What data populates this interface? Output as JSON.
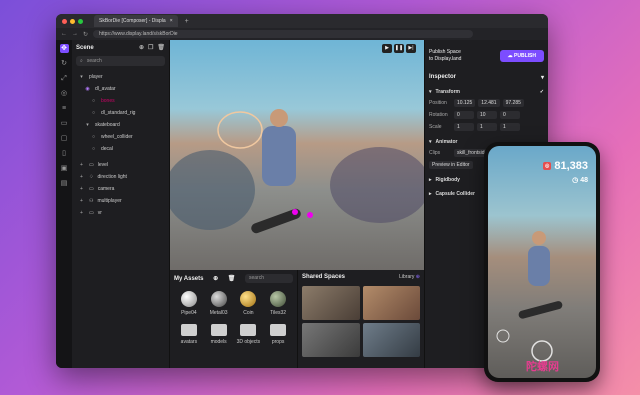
{
  "browser": {
    "tab_title": "SkBorDie [Composer] - Displa",
    "url": "https://www.display.land/s/skBorDie"
  },
  "scene": {
    "title": "Scene",
    "search_placeholder": "search",
    "tree": [
      {
        "label": "player"
      },
      {
        "label": "dl_avatar"
      },
      {
        "label": "bones"
      },
      {
        "label": "dl_standard_rig"
      },
      {
        "label": "skateboard"
      },
      {
        "label": "wheel_collider"
      },
      {
        "label": "decal"
      },
      {
        "label": "level"
      },
      {
        "label": "direction light"
      },
      {
        "label": "camera"
      },
      {
        "label": "multiplayer"
      },
      {
        "label": "vr"
      }
    ]
  },
  "assets": {
    "title": "My Assets",
    "search_placeholder": "search",
    "items": [
      {
        "label": "Pipe04",
        "color": "#d9d9d9"
      },
      {
        "label": "Metal03",
        "color": "#8a8a8a"
      },
      {
        "label": "Coin",
        "color": "#d9a83a"
      },
      {
        "label": "Tiles32",
        "color": "#7b8f6c"
      }
    ],
    "folders": [
      "avatars",
      "models",
      "3D objects",
      "props"
    ]
  },
  "shared": {
    "title": "Shared Spaces",
    "library": "Library"
  },
  "inspector": {
    "publish_line1": "Publish Space",
    "publish_line2": "to Display.land",
    "publish_btn": "PUBLISH",
    "title": "Inspector",
    "transform": "Transform",
    "position_label": "Position",
    "position": [
      "10.125",
      "12.481",
      "97.285"
    ],
    "rotation_label": "Rotation",
    "rotation": [
      "0",
      "10",
      "0"
    ],
    "scale_label": "Scale",
    "scale": [
      "1",
      "1",
      "1"
    ],
    "animator": "Animator",
    "clips_label": "Clips",
    "clips_value": "skill_frontside_p",
    "preview": "Preview in Editor",
    "rigidbody": "Rigidbody",
    "capsule": "Capsule Collider"
  },
  "phone": {
    "score": "81,383",
    "timer": "48"
  },
  "watermark": "陀螺网"
}
